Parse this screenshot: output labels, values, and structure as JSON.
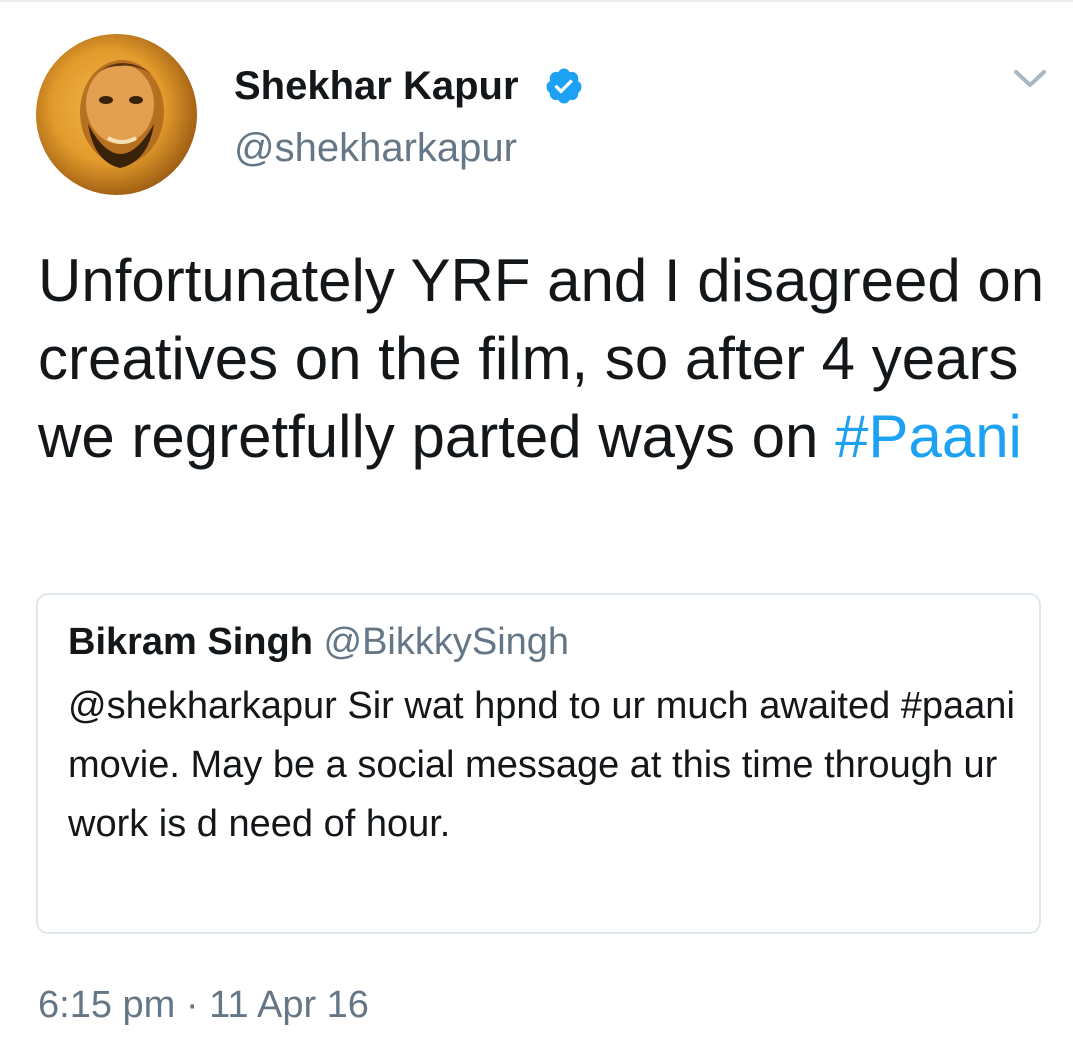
{
  "tweet": {
    "author_name": "Shekhar Kapur",
    "author_handle": "@shekharkapur",
    "verified": true,
    "text_before_hashtag": "Unfortunately YRF and I disagreed on creatives on the film, so after 4 years we regretfully parted ways on ",
    "hashtag": "#Paani",
    "timestamp": "6:15 pm · 11 Apr 16"
  },
  "quoted_tweet": {
    "author_name": "Bikram Singh",
    "author_handle": "@BikkkySingh",
    "text": "@shekharkapur Sir wat hpnd to ur much awaited #paani movie. May be a social message at this time through ur work is d need of hour."
  },
  "icons": {
    "verified": "verified-badge-icon",
    "chevron": "chevron-down-icon",
    "avatar": "avatar"
  },
  "colors": {
    "link": "#1da1f2",
    "verified": "#1da1f2",
    "muted": "#657786",
    "text": "#14171a",
    "border": "#e1e8ed"
  }
}
